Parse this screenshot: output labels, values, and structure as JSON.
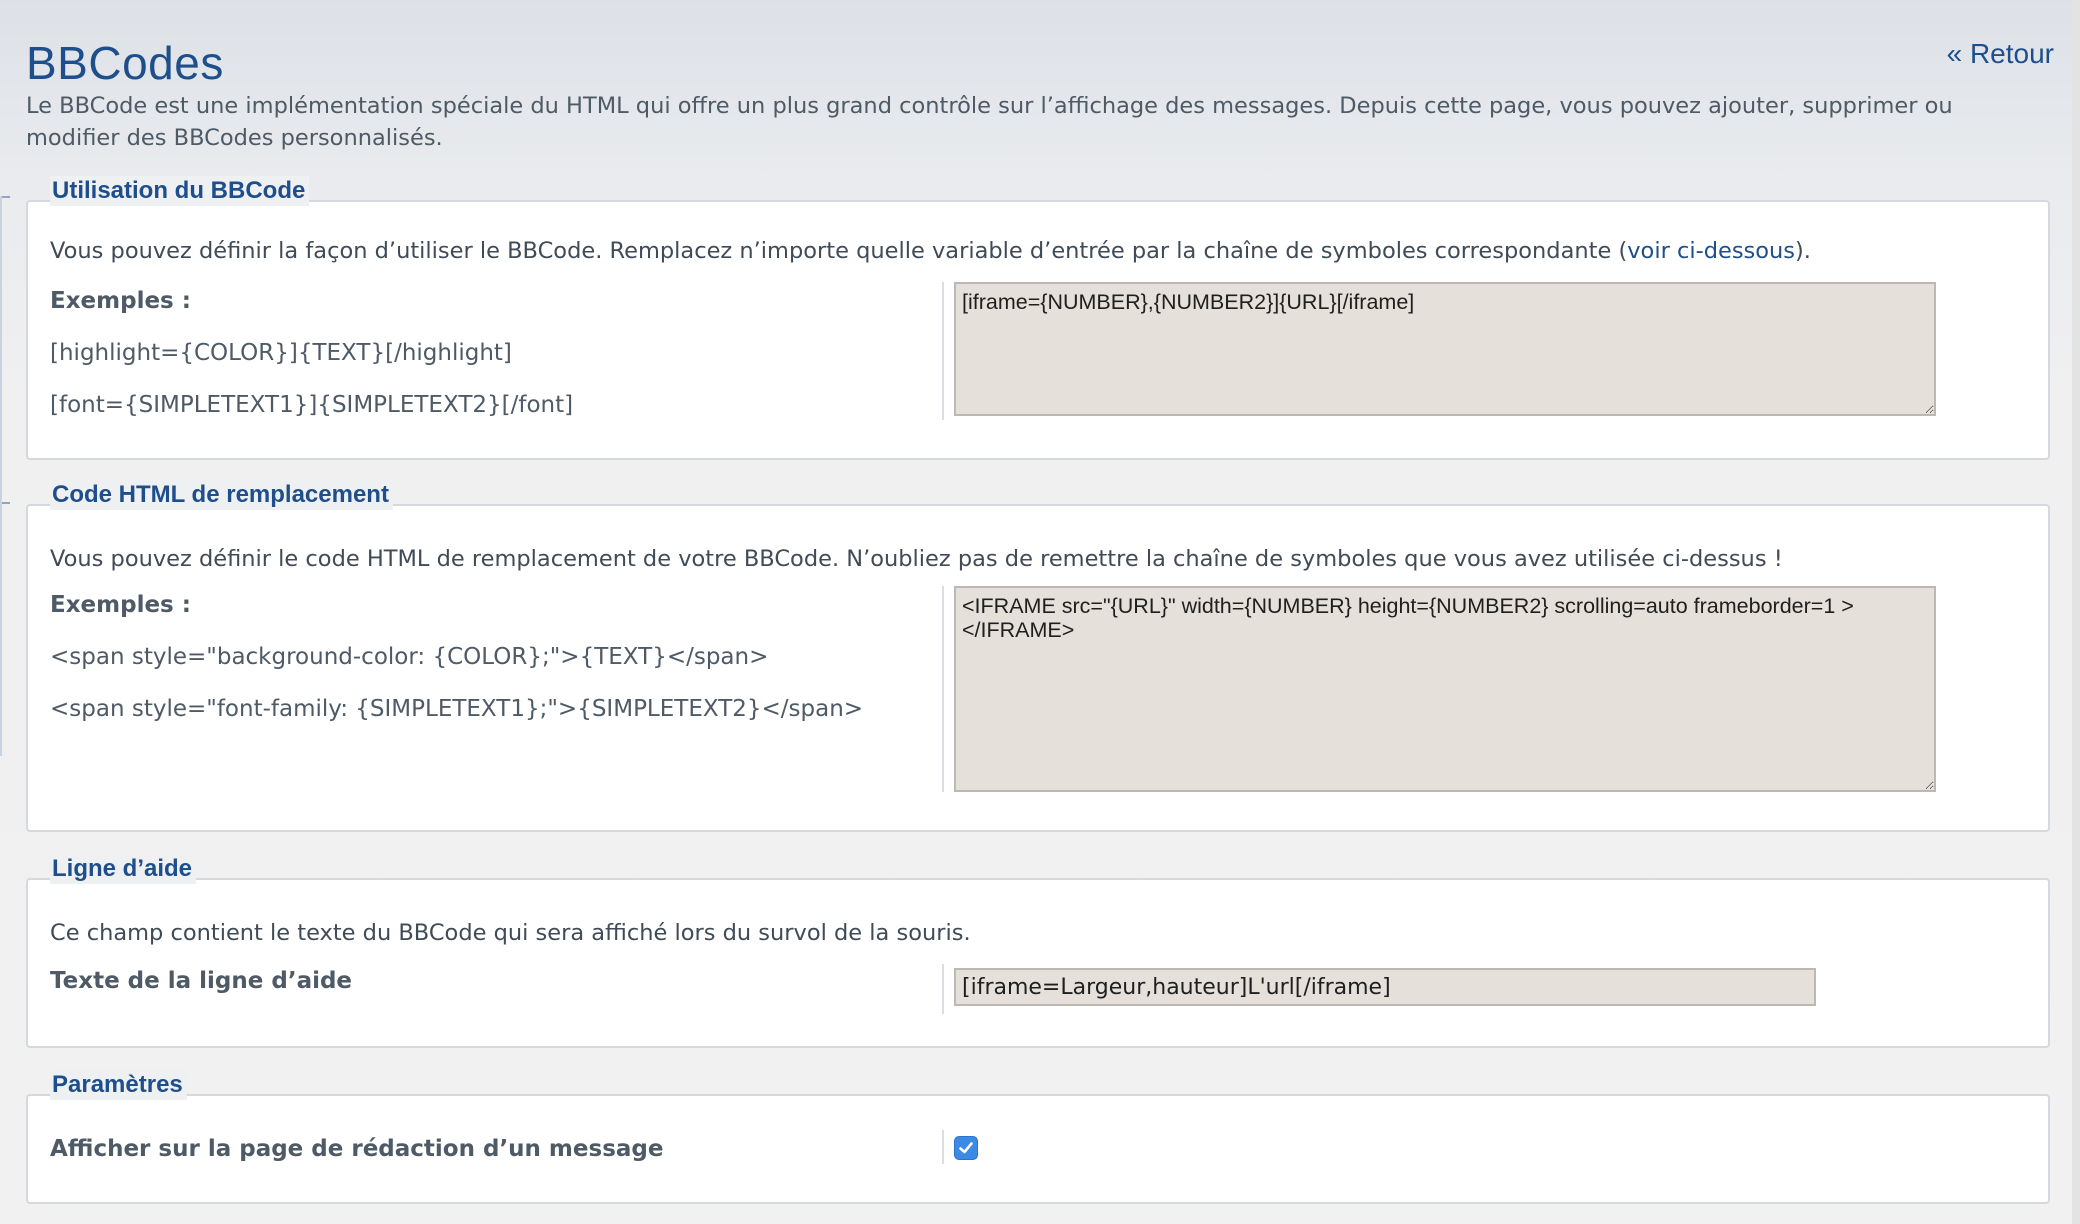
{
  "header": {
    "title": "BBCodes",
    "back_link": "« Retour",
    "intro": "Le BBCode est une implémentation spéciale du HTML qui offre un plus grand contrôle sur l’affichage des messages. Depuis cette page, vous pouvez ajouter, supprimer ou modifier des BBCodes personnalisés."
  },
  "usage": {
    "legend": "Utilisation du BBCode",
    "desc_before": "Vous pouvez définir la façon d’utiliser le BBCode. Remplacez n’importe quelle variable d’entrée par la chaîne de symboles correspondante (",
    "desc_link": "voir ci-dessous",
    "desc_after": ").",
    "examples_label": "Exemples :",
    "examples": [
      "[highlight={COLOR}]{TEXT}[/highlight]",
      "[font={SIMPLETEXT1}]{SIMPLETEXT2}[/font]"
    ],
    "value": "[iframe={NUMBER},{NUMBER2}]{URL}[/iframe]"
  },
  "html_code": {
    "legend": "Code HTML de remplacement",
    "desc": "Vous pouvez définir le code HTML de remplacement de votre BBCode. N’oubliez pas de remettre la chaîne de symboles que vous avez utilisée ci-dessus !",
    "examples_label": "Exemples :",
    "examples": [
      "<span style=\"background-color: {COLOR};\">{TEXT}</span>",
      "<span style=\"font-family: {SIMPLETEXT1};\">{SIMPLETEXT2}</span>"
    ],
    "value": "<IFRAME src=\"{URL}\" width={NUMBER} height={NUMBER2} scrolling=auto frameborder=1 ></IFRAME>"
  },
  "help_line": {
    "legend": "Ligne d’aide",
    "desc": "Ce champ contient le texte du BBCode qui sera affiché lors du survol de la souris.",
    "field_label": "Texte de la ligne d’aide",
    "value": "[iframe=Largeur,hauteur]L'url[/iframe]"
  },
  "settings": {
    "legend": "Paramètres",
    "field_label": "Afficher sur la page de rédaction d’un message",
    "checked": true
  },
  "colors": {
    "accent": "#1e4f8c",
    "field_bg": "#e5e0d9",
    "checkbox": "#3b8be6"
  }
}
